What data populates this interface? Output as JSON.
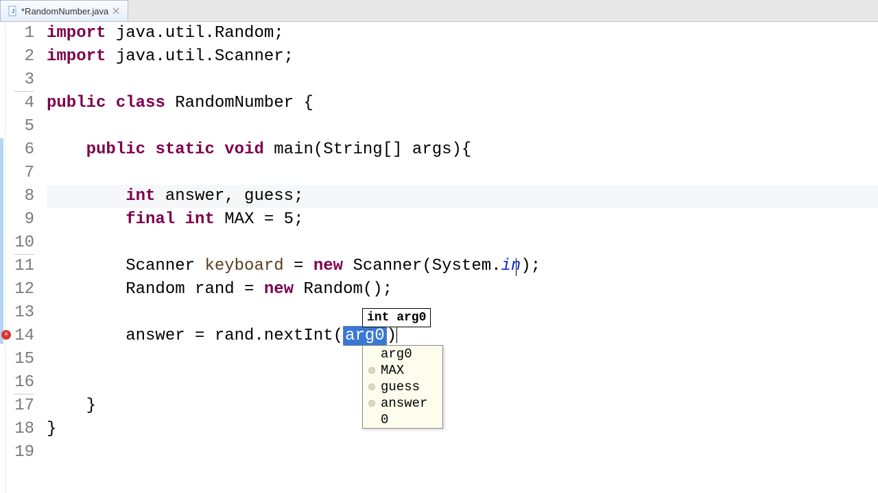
{
  "tab": {
    "title": "*RandomNumber.java"
  },
  "gutter": {
    "lines": [
      "1",
      "2",
      "3",
      "4",
      "5",
      "6",
      "7",
      "8",
      "9",
      "10",
      "11",
      "12",
      "13",
      "14",
      "15",
      "16",
      "17",
      "18",
      "19"
    ]
  },
  "code": {
    "l1": {
      "kw1": "import",
      "rest": " java.util.Random;"
    },
    "l2": {
      "kw1": "import",
      "rest": " java.util.Scanner;"
    },
    "l4": {
      "kw1": "public",
      "kw2": "class",
      "name": " RandomNumber {"
    },
    "l6": {
      "kw1": "public",
      "kw2": "static",
      "kw3": "void",
      "sig": " main(String[] args){"
    },
    "l8": {
      "kw1": "int",
      "vars": " answer, guess;"
    },
    "l9": {
      "kw1": "final",
      "kw2": "int",
      "rest": " MAX = 5;"
    },
    "l11": {
      "type": "Scanner ",
      "var": "keyboard",
      "eq": " = ",
      "newkw": "new",
      "ctor": " Scanner(System.",
      "static": "in",
      "close": ");"
    },
    "l12": {
      "pre": "Random rand = ",
      "newkw": "new",
      "ctor": " Random();"
    },
    "l14": {
      "pre": "answer = rand.nextInt(",
      "arg": "arg0",
      "post": ")"
    },
    "l17": {
      "brace": "}"
    },
    "l18": {
      "brace": "}"
    }
  },
  "hint": {
    "text": "int arg0"
  },
  "autocomplete": {
    "items": [
      {
        "label": "arg0",
        "dot": false
      },
      {
        "label": "MAX",
        "dot": true
      },
      {
        "label": "guess",
        "dot": true
      },
      {
        "label": "answer",
        "dot": true
      },
      {
        "label": "0",
        "dot": false
      }
    ]
  }
}
